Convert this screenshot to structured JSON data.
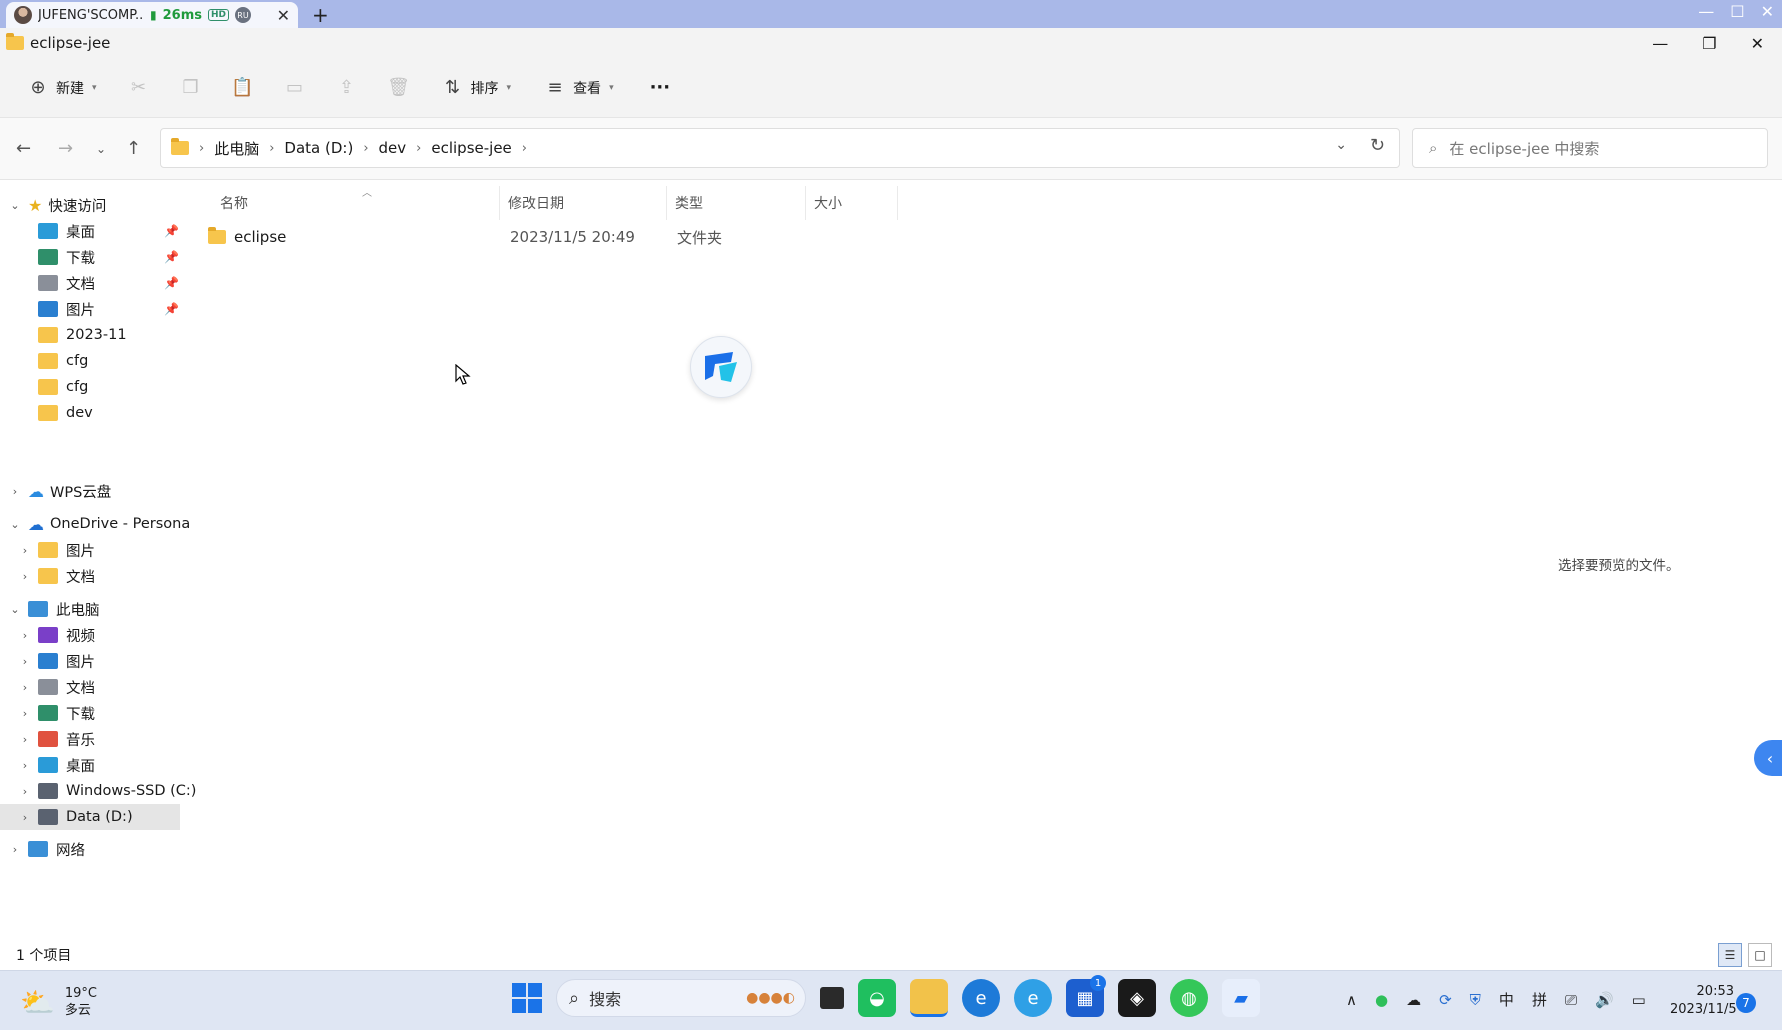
{
  "remote_tab": {
    "title": "JUFENG'SCOMP...",
    "latency": "26ms",
    "quality_badge": "HD",
    "region_badge": "RU",
    "close": "✕",
    "add": "+"
  },
  "window": {
    "title": "eclipse-jee",
    "controls": {
      "minimize": "—",
      "restore": "❐",
      "close": "✕"
    }
  },
  "toolbar": {
    "new_label": "新建",
    "sort_label": "排序",
    "view_label": "查看",
    "more_label": "···"
  },
  "address": {
    "crumbs": [
      "此电脑",
      "Data (D:)",
      "dev",
      "eclipse-jee"
    ],
    "search_placeholder": "在 eclipse-jee 中搜索"
  },
  "nav": {
    "quick_access": "快速访问",
    "quick_items": [
      {
        "label": "桌面",
        "icon": "desktop-icon",
        "color": "#2a9bd8",
        "pinned": true
      },
      {
        "label": "下载",
        "icon": "download-icon",
        "color": "#2f8f6a",
        "pinned": true
      },
      {
        "label": "文档",
        "icon": "document-icon",
        "color": "#8a8f99",
        "pinned": true
      },
      {
        "label": "图片",
        "icon": "pictures-icon",
        "color": "#2a7fd0",
        "pinned": true
      },
      {
        "label": "2023-11",
        "icon": "folder-icon",
        "color": "#f7c54c",
        "pinned": false
      },
      {
        "label": "cfg",
        "icon": "folder-icon",
        "color": "#f7c54c",
        "pinned": false
      },
      {
        "label": "cfg",
        "icon": "folder-icon",
        "color": "#f7c54c",
        "pinned": false
      },
      {
        "label": "dev",
        "icon": "folder-icon",
        "color": "#f7c54c",
        "pinned": false
      }
    ],
    "wps": "WPS云盘",
    "onedrive": "OneDrive - Persona",
    "onedrive_items": [
      "图片",
      "文档"
    ],
    "this_pc": "此电脑",
    "pc_items": [
      {
        "label": "视频",
        "icon": "videos-icon",
        "color": "#7a3fc8"
      },
      {
        "label": "图片",
        "icon": "pictures-icon",
        "color": "#2a7fd0"
      },
      {
        "label": "文档",
        "icon": "document-icon",
        "color": "#8a8f99"
      },
      {
        "label": "下载",
        "icon": "download-icon",
        "color": "#2f8f6a"
      },
      {
        "label": "音乐",
        "icon": "music-icon",
        "color": "#e0523f"
      },
      {
        "label": "桌面",
        "icon": "desktop-icon",
        "color": "#2a9bd8"
      },
      {
        "label": "Windows-SSD (C:)",
        "icon": "drive-c-icon",
        "color": "#5a6270"
      },
      {
        "label": "Data (D:)",
        "icon": "drive-d-icon",
        "color": "#5a6270"
      }
    ],
    "network": "网络"
  },
  "columns": {
    "name": "名称",
    "modified": "修改日期",
    "type": "类型",
    "size": "大小"
  },
  "files": [
    {
      "name": "eclipse",
      "modified": "2023/11/5 20:49",
      "type": "文件夹",
      "size": ""
    }
  ],
  "preview_message": "选择要预览的文件。",
  "status": {
    "item_count": "1 个项目"
  },
  "taskbar": {
    "weather_temp": "19°C",
    "weather_desc": "多云",
    "search_label": "搜索",
    "apps_badge": "1",
    "tray_ime_1": "中",
    "tray_ime_2": "拼",
    "time": "20:53",
    "date": "2023/11/5",
    "notifications": "7"
  }
}
